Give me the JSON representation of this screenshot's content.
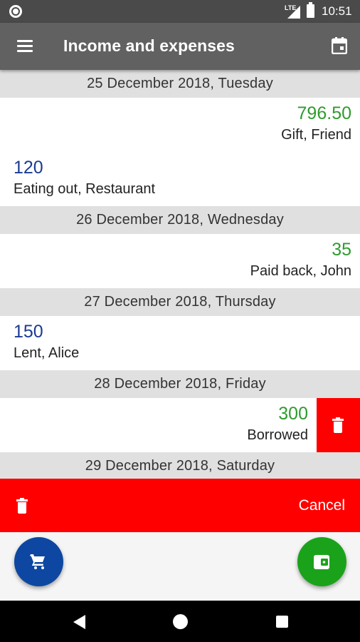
{
  "status_bar": {
    "time": "10:51",
    "network_label": "LTE"
  },
  "app_bar": {
    "title": "Income and expenses"
  },
  "days": [
    {
      "date": "25 December 2018, Tuesday",
      "entries": [
        {
          "type": "income",
          "amount": "796.50",
          "description": "Gift, Friend"
        },
        {
          "type": "expense",
          "amount": "120",
          "description": "Eating out, Restaurant"
        }
      ]
    },
    {
      "date": "26 December 2018, Wednesday",
      "entries": [
        {
          "type": "income",
          "amount": "35",
          "description": "Paid back, John"
        }
      ]
    },
    {
      "date": "27 December 2018, Thursday",
      "entries": [
        {
          "type": "expense",
          "amount": "150",
          "description": "Lent, Alice"
        }
      ]
    },
    {
      "date": "28 December 2018, Friday",
      "entries": [
        {
          "type": "income",
          "amount": "300",
          "description": "Borrowed",
          "swiped": true
        }
      ]
    },
    {
      "date": "29 December 2018, Saturday",
      "entries": []
    }
  ],
  "delete_bar": {
    "cancel_label": "Cancel"
  },
  "colors": {
    "income": "#2e9b2e",
    "expense": "#1c3a94",
    "delete": "#ff0000",
    "app_bar": "#616161",
    "fab_expense": "#0d47a1",
    "fab_income": "#1aa31a"
  },
  "fabs": {
    "expense_icon": "shopping-cart-icon",
    "income_icon": "wallet-icon"
  }
}
